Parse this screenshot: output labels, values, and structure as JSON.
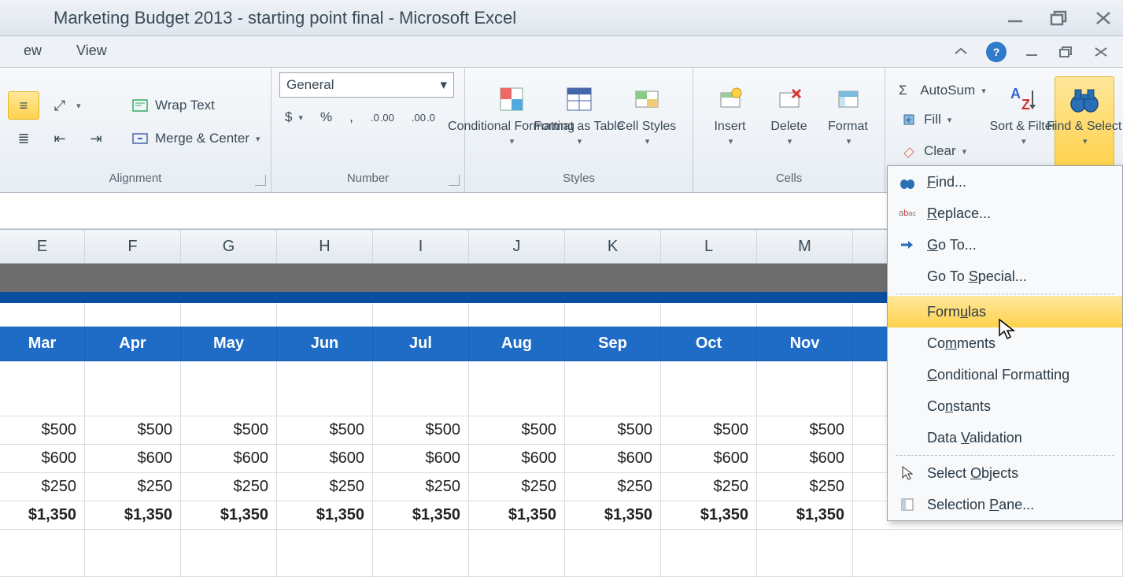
{
  "window": {
    "title": "Marketing Budget 2013 - starting point final - Microsoft Excel"
  },
  "tabs": {
    "ew": "ew",
    "view": "View"
  },
  "help_glyph": "?",
  "ribbon": {
    "alignment": {
      "wrap": "Wrap Text",
      "merge": "Merge & Center",
      "label": "Alignment"
    },
    "number": {
      "format": "General",
      "dollar": "$",
      "percent": "%",
      "comma": ",",
      "inc": ".0 .00",
      "dec": ".00 .0",
      "label": "Number"
    },
    "styles": {
      "cond": "Conditional Formatting",
      "table": "Format as Table",
      "cell": "Cell Styles",
      "label": "Styles"
    },
    "cells": {
      "insert": "Insert",
      "delete": "Delete",
      "format": "Format",
      "label": "Cells"
    },
    "editing": {
      "autosum": "AutoSum",
      "fill": "Fill",
      "clear": "Clear",
      "sort": "Sort & Filter",
      "find": "Find & Select"
    }
  },
  "dropdown": {
    "find": "Find...",
    "replace": "Replace...",
    "goto": "Go To...",
    "gotospecial": "Go To Special...",
    "formulas": "Formulas",
    "comments": "Comments",
    "condfmt": "Conditional Formatting",
    "constants": "Constants",
    "datavalid": "Data Validation",
    "selobj": "Select Objects",
    "selpane": "Selection Pane..."
  },
  "columns": [
    "E",
    "F",
    "G",
    "H",
    "I",
    "J",
    "K",
    "L",
    "M"
  ],
  "months": [
    "Mar",
    "Apr",
    "May",
    "Jun",
    "Jul",
    "Aug",
    "Sep",
    "Oct",
    "Nov"
  ],
  "rows": [
    [
      "$500",
      "$500",
      "$500",
      "$500",
      "$500",
      "$500",
      "$500",
      "$500",
      "$500"
    ],
    [
      "$600",
      "$600",
      "$600",
      "$600",
      "$600",
      "$600",
      "$600",
      "$600",
      "$600"
    ],
    [
      "$250",
      "$250",
      "$250",
      "$250",
      "$250",
      "$250",
      "$250",
      "$250",
      "$250"
    ]
  ],
  "totals": [
    "$1,350",
    "$1,350",
    "$1,350",
    "$1,350",
    "$1,350",
    "$1,350",
    "$1,350",
    "$1,350",
    "$1,350"
  ]
}
